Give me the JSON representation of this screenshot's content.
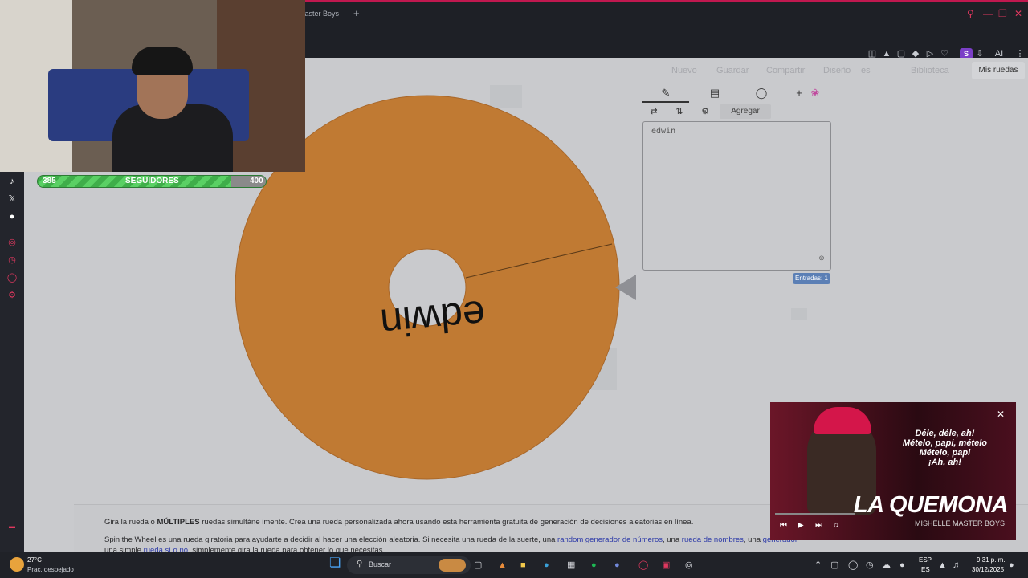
{
  "browser": {
    "tab_title": "Master Boys",
    "new_tab": "+",
    "ai_label": "AI",
    "profile_initial": "S"
  },
  "overlay": {
    "followers_current": "385",
    "followers_label": "SEGUIDORES",
    "followers_goal": "400",
    "progress_fraction": 0.9625
  },
  "nav": {
    "items": [
      "Nuevo",
      "Guardar",
      "Compartir",
      "Diseño",
      "es",
      "Biblioteca"
    ],
    "my_wheels": "Mis ruedas"
  },
  "wheel": {
    "entry_text": "edwin",
    "color": "#c07a33"
  },
  "editor": {
    "add_label": "Agregar",
    "entries_text": "edwin",
    "entries_badge": "Entradas: 1"
  },
  "description": {
    "line1_pre": "Gira la rueda o ",
    "line1_bold": "MÚLTIPLES",
    "line1_post": " ruedas simultáne imente. Crea una rueda personalizada ahora usando esta herramienta gratuita de generación de decisiones aleatorias en línea.",
    "line2_pre": "Spin the Wheel es una rueda giratoria para ayudarte a decidir al hacer una elección aleatoria. Si necesita una rueda de la suerte, una ",
    "link_numbers": "random generador de números",
    "line2_mid1": ", una ",
    "link_names": "rueda de nombres",
    "line2_mid2": ", una ",
    "link_generator": "generador",
    "line3_pre": "una simple ",
    "link_yesno": "rueda sí o no",
    "line3_post": ", simplemente gira la rueda para obtener lo que necesitas."
  },
  "player": {
    "lyrics": [
      "Déle, déle, ah!",
      "Mételo, papi, mételo",
      "Mételo, papi",
      "¡Ah, ah!"
    ],
    "title": "LA QUEMONA",
    "artist": "MISHELLE MASTER BOYS"
  },
  "taskbar": {
    "temperature": "27°C",
    "weather": "Prac. despejado",
    "search_placeholder": "Buscar",
    "lang_top": "ESP",
    "lang_bottom": "ES",
    "time": "9:31 p. m.",
    "date": "30/12/2025"
  },
  "icons": {
    "rail": [
      "tiktok-icon",
      "x-icon",
      "discord-icon",
      "kick-icon",
      "clock-icon",
      "chat-icon",
      "settings-icon"
    ],
    "accent": "#e0385f"
  }
}
